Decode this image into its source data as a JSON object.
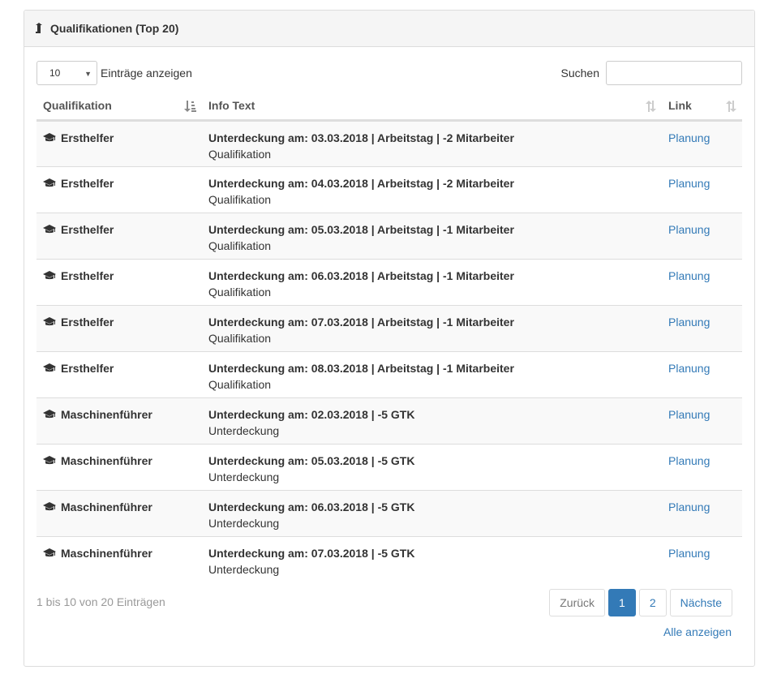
{
  "panel": {
    "title": "Qualifikationen (Top 20)",
    "icon": "level-up-icon"
  },
  "length": {
    "selected": "10",
    "label": "Einträge anzeigen"
  },
  "search": {
    "label": "Suchen",
    "value": "",
    "placeholder": ""
  },
  "table": {
    "columns": [
      "Qualifikation",
      "Info Text",
      "Link"
    ],
    "rows": [
      {
        "qual": "Ersthelfer",
        "title": "Unterdeckung am: 03.03.2018 | Arbeitstag | -2 Mitarbeiter",
        "sub": "Qualifikation",
        "link": "Planung"
      },
      {
        "qual": "Ersthelfer",
        "title": "Unterdeckung am: 04.03.2018 | Arbeitstag | -2 Mitarbeiter",
        "sub": "Qualifikation",
        "link": "Planung"
      },
      {
        "qual": "Ersthelfer",
        "title": "Unterdeckung am: 05.03.2018 | Arbeitstag | -1 Mitarbeiter",
        "sub": "Qualifikation",
        "link": "Planung"
      },
      {
        "qual": "Ersthelfer",
        "title": "Unterdeckung am: 06.03.2018 | Arbeitstag | -1 Mitarbeiter",
        "sub": "Qualifikation",
        "link": "Planung"
      },
      {
        "qual": "Ersthelfer",
        "title": "Unterdeckung am: 07.03.2018 | Arbeitstag | -1 Mitarbeiter",
        "sub": "Qualifikation",
        "link": "Planung"
      },
      {
        "qual": "Ersthelfer",
        "title": "Unterdeckung am: 08.03.2018 | Arbeitstag | -1 Mitarbeiter",
        "sub": "Qualifikation",
        "link": "Planung"
      },
      {
        "qual": "Maschinenführer",
        "title": "Unterdeckung am: 02.03.2018 | -5 GTK",
        "sub": "Unterdeckung",
        "link": "Planung"
      },
      {
        "qual": "Maschinenführer",
        "title": "Unterdeckung am: 05.03.2018 | -5 GTK",
        "sub": "Unterdeckung",
        "link": "Planung"
      },
      {
        "qual": "Maschinenführer",
        "title": "Unterdeckung am: 06.03.2018 | -5 GTK",
        "sub": "Unterdeckung",
        "link": "Planung"
      },
      {
        "qual": "Maschinenführer",
        "title": "Unterdeckung am: 07.03.2018 | -5 GTK",
        "sub": "Unterdeckung",
        "link": "Planung"
      }
    ]
  },
  "footer": {
    "info": "1 bis 10 von 20 Einträgen",
    "prev": "Zurück",
    "pages": [
      "1",
      "2"
    ],
    "active_page": "1",
    "next": "Nächste",
    "show_all": "Alle anzeigen"
  },
  "colors": {
    "link": "#337ab7",
    "active_page": "#337ab7",
    "stripe": "#f9f9f9",
    "border": "#dddddd"
  }
}
